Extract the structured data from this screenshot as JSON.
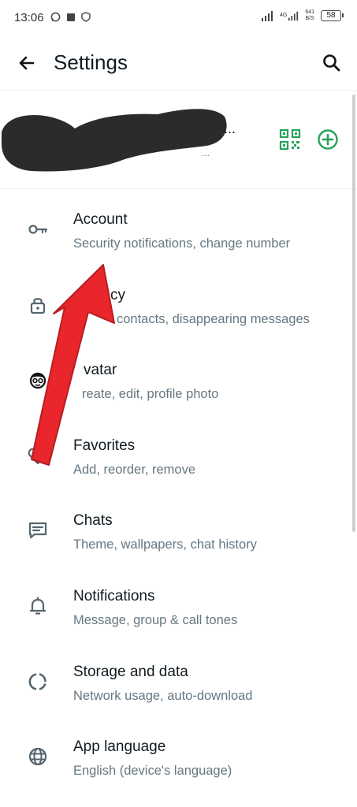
{
  "status_bar": {
    "time": "13:06",
    "network_type": "4G",
    "speed_value": "641",
    "speed_unit": "B/S",
    "battery": "58"
  },
  "header": {
    "title": "Settings",
    "back_icon": "arrow-left-icon",
    "search_icon": "search-icon"
  },
  "profile": {
    "name_tail": "...",
    "about_tail": "...",
    "qr_icon": "qr-code-icon",
    "add_icon": "add-circle-icon"
  },
  "items": [
    {
      "title": "Account",
      "subtitle": "Security notifications, change number",
      "icon": "key-icon"
    },
    {
      "title": "cy",
      "subtitle": "contacts, disappearing messages",
      "icon": "lock-icon"
    },
    {
      "title": "vatar",
      "subtitle": "reate, edit, profile photo",
      "icon": "avatar-icon"
    },
    {
      "title": "Favorites",
      "subtitle": "Add, reorder, remove",
      "icon": "heart-icon"
    },
    {
      "title": "Chats",
      "subtitle": "Theme, wallpapers, chat history",
      "icon": "chat-icon"
    },
    {
      "title": "Notifications",
      "subtitle": "Message, group & call tones",
      "icon": "bell-icon"
    },
    {
      "title": "Storage and data",
      "subtitle": "Network usage, auto-download",
      "icon": "storage-icon"
    },
    {
      "title": "App language",
      "subtitle": "English (device's language)",
      "icon": "globe-icon"
    }
  ],
  "colors": {
    "accent": "#25a35a",
    "arrow": "#e8262b",
    "text_primary": "#111b21",
    "text_secondary": "#667781",
    "icon": "#54656f"
  }
}
